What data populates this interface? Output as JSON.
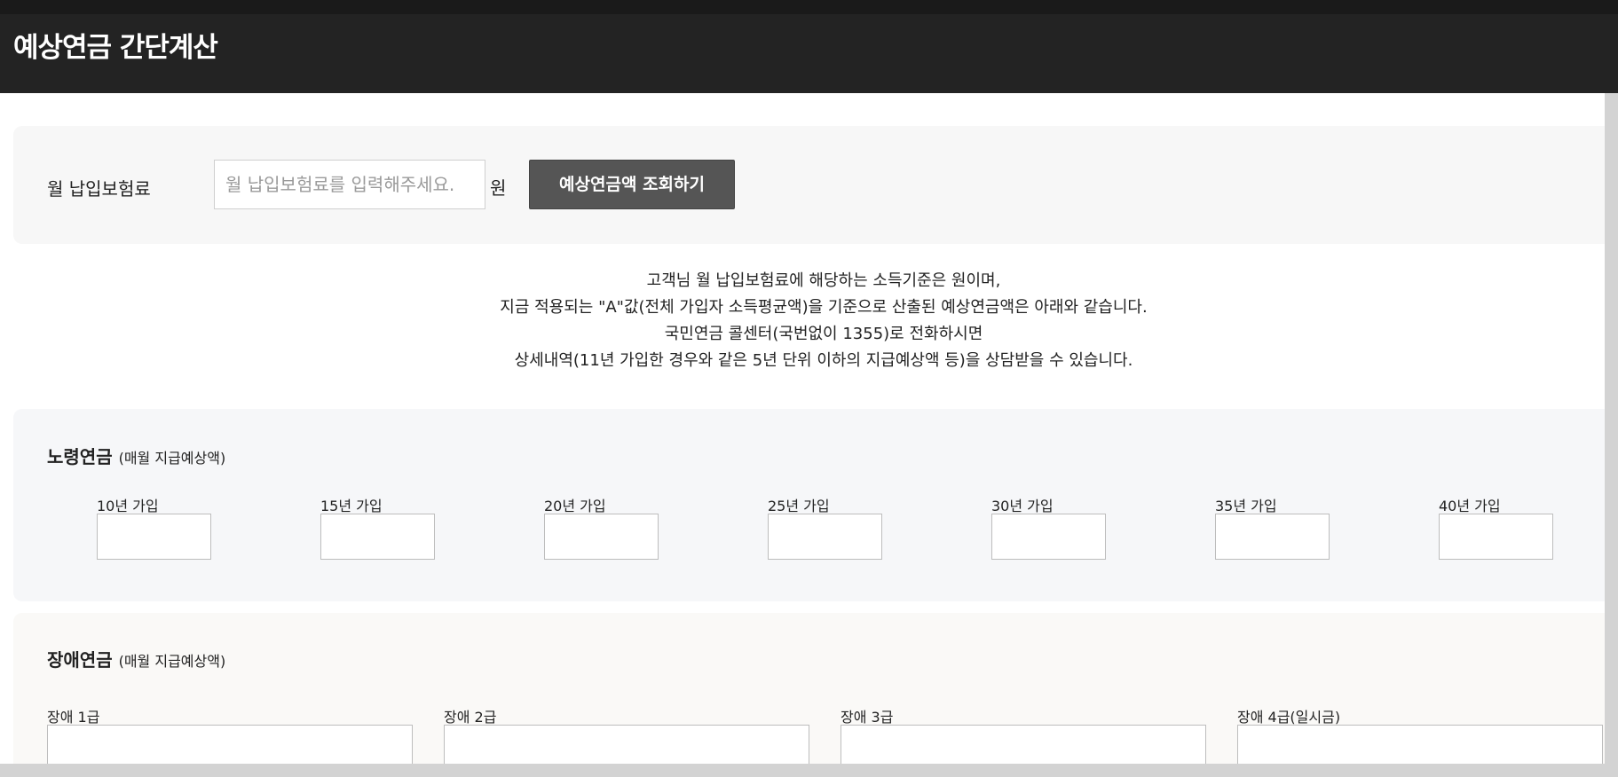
{
  "header": {
    "title": "예상연금 간단계산"
  },
  "input_panel": {
    "label": "월 납입보험료",
    "placeholder": "월 납입보험료를 입력해주세요.",
    "value": "",
    "unit": "원",
    "button_label": "예상연금액 조회하기"
  },
  "info_lines": [
    "고객님 월 납입보험료에 해당하는 소득기준은 원이며,",
    "지금 적용되는 \"A\"값(전체 가입자 소득평균액)을 기준으로 산출된 예상연금액은 아래와 같습니다.",
    "국민연금 콜센터(국번없이 1355)로 전화하시면",
    "상세내역(11년 가입한 경우와 같은 5년 단위 이하의 지급예상액 등)을 상담받을 수 있습니다."
  ],
  "aging_pension": {
    "title": "노령연금",
    "subtitle": "(매월 지급예상액)",
    "columns": [
      {
        "label": "10년 가입",
        "value": ""
      },
      {
        "label": "15년 가입",
        "value": ""
      },
      {
        "label": "20년 가입",
        "value": ""
      },
      {
        "label": "25년 가입",
        "value": ""
      },
      {
        "label": "30년 가입",
        "value": ""
      },
      {
        "label": "35년 가입",
        "value": ""
      },
      {
        "label": "40년 가입",
        "value": ""
      }
    ]
  },
  "disability_pension": {
    "title": "장애연금",
    "subtitle": "(매월 지급예상액)",
    "columns": [
      {
        "label": "장애 1급",
        "value": ""
      },
      {
        "label": "장애 2급",
        "value": ""
      },
      {
        "label": "장애 3급",
        "value": ""
      },
      {
        "label": "장애 4급(일시금)",
        "value": ""
      }
    ]
  }
}
